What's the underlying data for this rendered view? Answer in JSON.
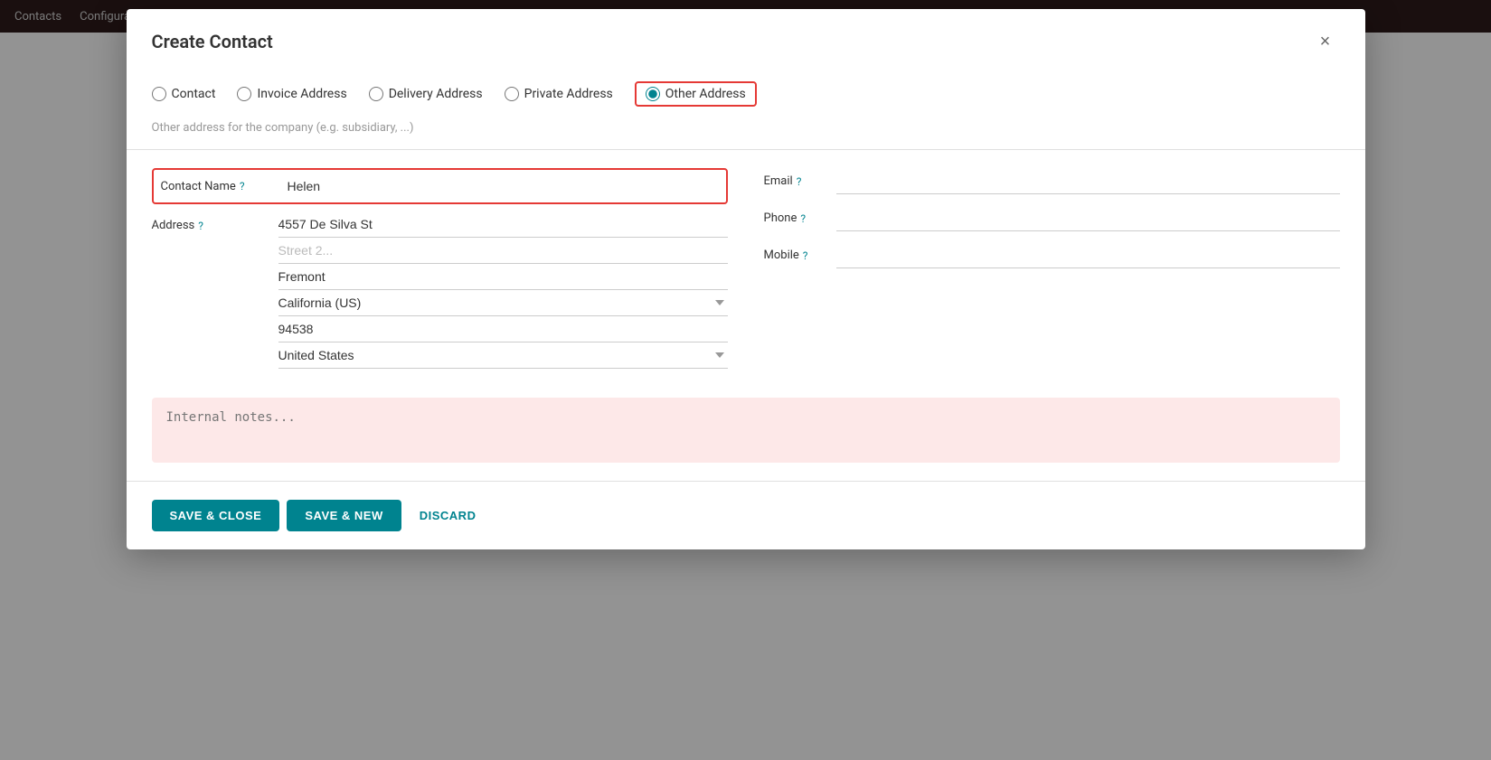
{
  "modal": {
    "title": "Create Contact",
    "close_label": "×"
  },
  "address_types": [
    {
      "id": "contact",
      "label": "Contact",
      "selected": false
    },
    {
      "id": "invoice",
      "label": "Invoice Address",
      "selected": false
    },
    {
      "id": "delivery",
      "label": "Delivery Address",
      "selected": false
    },
    {
      "id": "private",
      "label": "Private Address",
      "selected": false
    },
    {
      "id": "other",
      "label": "Other Address",
      "selected": true
    }
  ],
  "address_description": "Other address for the company (e.g. subsidiary, ...)",
  "form": {
    "contact_name_label": "Contact Name",
    "contact_name_value": "Helen",
    "address_label": "Address",
    "street1_value": "4557 De Silva St",
    "street2_placeholder": "Street 2...",
    "city_value": "Fremont",
    "state_value": "California (US)",
    "zip_value": "94538",
    "country_value": "United States",
    "email_label": "Email",
    "email_value": "",
    "phone_label": "Phone",
    "phone_value": "",
    "mobile_label": "Mobile",
    "mobile_value": "",
    "notes_placeholder": "Internal notes..."
  },
  "buttons": {
    "save_close": "SAVE & CLOSE",
    "save_new": "SAVE & NEW",
    "discard": "DISCARD"
  }
}
